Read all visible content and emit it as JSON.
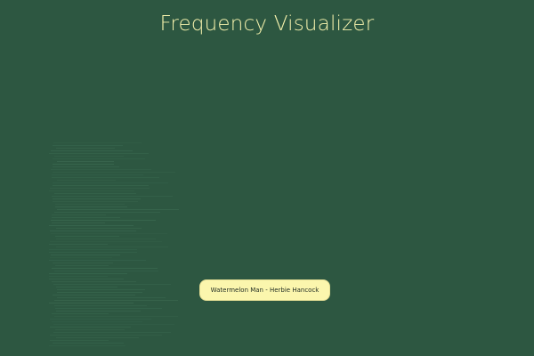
{
  "app": {
    "title": "Frequency Visualizer"
  },
  "player": {
    "track_label": "Watermelon Man - Herbie Hancock"
  },
  "colors": {
    "background": "#2d5741",
    "title": "#f4f1ac",
    "button_background": "#fbf6ad",
    "button_text": "#1f2b22"
  }
}
